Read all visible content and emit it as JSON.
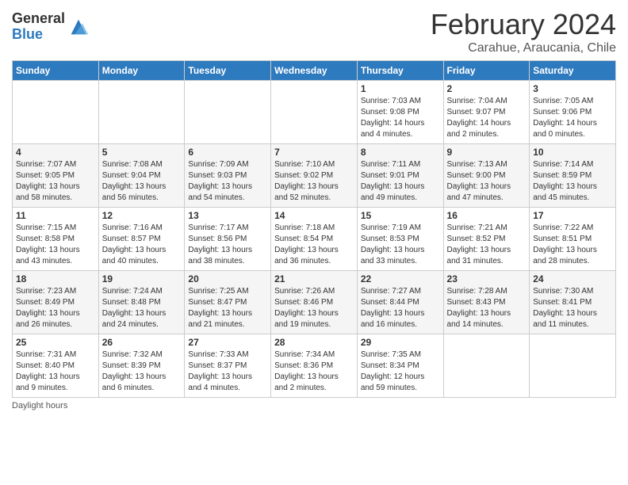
{
  "header": {
    "logo_general": "General",
    "logo_blue": "Blue",
    "month_title": "February 2024",
    "subtitle": "Carahue, Araucania, Chile"
  },
  "days_of_week": [
    "Sunday",
    "Monday",
    "Tuesday",
    "Wednesday",
    "Thursday",
    "Friday",
    "Saturday"
  ],
  "weeks": [
    [
      {
        "day": "",
        "info": ""
      },
      {
        "day": "",
        "info": ""
      },
      {
        "day": "",
        "info": ""
      },
      {
        "day": "",
        "info": ""
      },
      {
        "day": "1",
        "info": "Sunrise: 7:03 AM\nSunset: 9:08 PM\nDaylight: 14 hours\nand 4 minutes."
      },
      {
        "day": "2",
        "info": "Sunrise: 7:04 AM\nSunset: 9:07 PM\nDaylight: 14 hours\nand 2 minutes."
      },
      {
        "day": "3",
        "info": "Sunrise: 7:05 AM\nSunset: 9:06 PM\nDaylight: 14 hours\nand 0 minutes."
      }
    ],
    [
      {
        "day": "4",
        "info": "Sunrise: 7:07 AM\nSunset: 9:05 PM\nDaylight: 13 hours\nand 58 minutes."
      },
      {
        "day": "5",
        "info": "Sunrise: 7:08 AM\nSunset: 9:04 PM\nDaylight: 13 hours\nand 56 minutes."
      },
      {
        "day": "6",
        "info": "Sunrise: 7:09 AM\nSunset: 9:03 PM\nDaylight: 13 hours\nand 54 minutes."
      },
      {
        "day": "7",
        "info": "Sunrise: 7:10 AM\nSunset: 9:02 PM\nDaylight: 13 hours\nand 52 minutes."
      },
      {
        "day": "8",
        "info": "Sunrise: 7:11 AM\nSunset: 9:01 PM\nDaylight: 13 hours\nand 49 minutes."
      },
      {
        "day": "9",
        "info": "Sunrise: 7:13 AM\nSunset: 9:00 PM\nDaylight: 13 hours\nand 47 minutes."
      },
      {
        "day": "10",
        "info": "Sunrise: 7:14 AM\nSunset: 8:59 PM\nDaylight: 13 hours\nand 45 minutes."
      }
    ],
    [
      {
        "day": "11",
        "info": "Sunrise: 7:15 AM\nSunset: 8:58 PM\nDaylight: 13 hours\nand 43 minutes."
      },
      {
        "day": "12",
        "info": "Sunrise: 7:16 AM\nSunset: 8:57 PM\nDaylight: 13 hours\nand 40 minutes."
      },
      {
        "day": "13",
        "info": "Sunrise: 7:17 AM\nSunset: 8:56 PM\nDaylight: 13 hours\nand 38 minutes."
      },
      {
        "day": "14",
        "info": "Sunrise: 7:18 AM\nSunset: 8:54 PM\nDaylight: 13 hours\nand 36 minutes."
      },
      {
        "day": "15",
        "info": "Sunrise: 7:19 AM\nSunset: 8:53 PM\nDaylight: 13 hours\nand 33 minutes."
      },
      {
        "day": "16",
        "info": "Sunrise: 7:21 AM\nSunset: 8:52 PM\nDaylight: 13 hours\nand 31 minutes."
      },
      {
        "day": "17",
        "info": "Sunrise: 7:22 AM\nSunset: 8:51 PM\nDaylight: 13 hours\nand 28 minutes."
      }
    ],
    [
      {
        "day": "18",
        "info": "Sunrise: 7:23 AM\nSunset: 8:49 PM\nDaylight: 13 hours\nand 26 minutes."
      },
      {
        "day": "19",
        "info": "Sunrise: 7:24 AM\nSunset: 8:48 PM\nDaylight: 13 hours\nand 24 minutes."
      },
      {
        "day": "20",
        "info": "Sunrise: 7:25 AM\nSunset: 8:47 PM\nDaylight: 13 hours\nand 21 minutes."
      },
      {
        "day": "21",
        "info": "Sunrise: 7:26 AM\nSunset: 8:46 PM\nDaylight: 13 hours\nand 19 minutes."
      },
      {
        "day": "22",
        "info": "Sunrise: 7:27 AM\nSunset: 8:44 PM\nDaylight: 13 hours\nand 16 minutes."
      },
      {
        "day": "23",
        "info": "Sunrise: 7:28 AM\nSunset: 8:43 PM\nDaylight: 13 hours\nand 14 minutes."
      },
      {
        "day": "24",
        "info": "Sunrise: 7:30 AM\nSunset: 8:41 PM\nDaylight: 13 hours\nand 11 minutes."
      }
    ],
    [
      {
        "day": "25",
        "info": "Sunrise: 7:31 AM\nSunset: 8:40 PM\nDaylight: 13 hours\nand 9 minutes."
      },
      {
        "day": "26",
        "info": "Sunrise: 7:32 AM\nSunset: 8:39 PM\nDaylight: 13 hours\nand 6 minutes."
      },
      {
        "day": "27",
        "info": "Sunrise: 7:33 AM\nSunset: 8:37 PM\nDaylight: 13 hours\nand 4 minutes."
      },
      {
        "day": "28",
        "info": "Sunrise: 7:34 AM\nSunset: 8:36 PM\nDaylight: 13 hours\nand 2 minutes."
      },
      {
        "day": "29",
        "info": "Sunrise: 7:35 AM\nSunset: 8:34 PM\nDaylight: 12 hours\nand 59 minutes."
      },
      {
        "day": "",
        "info": ""
      },
      {
        "day": "",
        "info": ""
      }
    ]
  ],
  "footer": {
    "label": "Daylight hours"
  }
}
